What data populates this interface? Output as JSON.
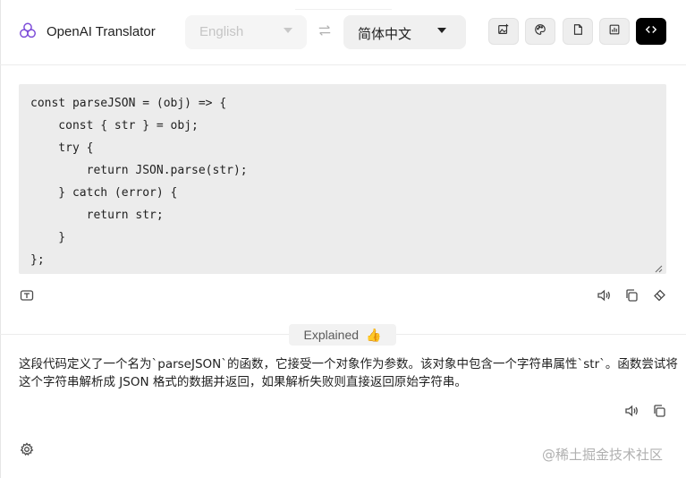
{
  "app": {
    "title": "OpenAI Translator",
    "logo_icon": "openai-knot-icon"
  },
  "languages": {
    "source": "English",
    "target": "简体中文",
    "swap_icon": "swap-arrows-icon"
  },
  "toolbar": {
    "buttons": [
      {
        "name": "image-ocr-icon",
        "active": false
      },
      {
        "name": "palette-icon",
        "active": false
      },
      {
        "name": "file-icon",
        "active": false
      },
      {
        "name": "chart-icon",
        "active": false
      },
      {
        "name": "code-icon",
        "active": true
      }
    ]
  },
  "editor": {
    "code": "const parseJSON = (obj) => {\n    const { str } = obj;\n    try {\n        return JSON.parse(str);\n    } catch (error) {\n        return str;\n    }\n};"
  },
  "mode_badge": {
    "label": "Explained",
    "emoji": "👍"
  },
  "result": {
    "text": "这段代码定义了一个名为`parseJSON`的函数，它接受一个对象作为参数。该对象中包含一个字符串属性`str`。函数尝试将这个字符串解析成 JSON 格式的数据并返回，如果解析失败则直接返回原始字符串。"
  },
  "watermark": "@稀土掘金技术社区",
  "colors": {
    "accent_active": "#000000",
    "editor_bg": "#ececec",
    "muted_text": "#c5c5c5"
  }
}
